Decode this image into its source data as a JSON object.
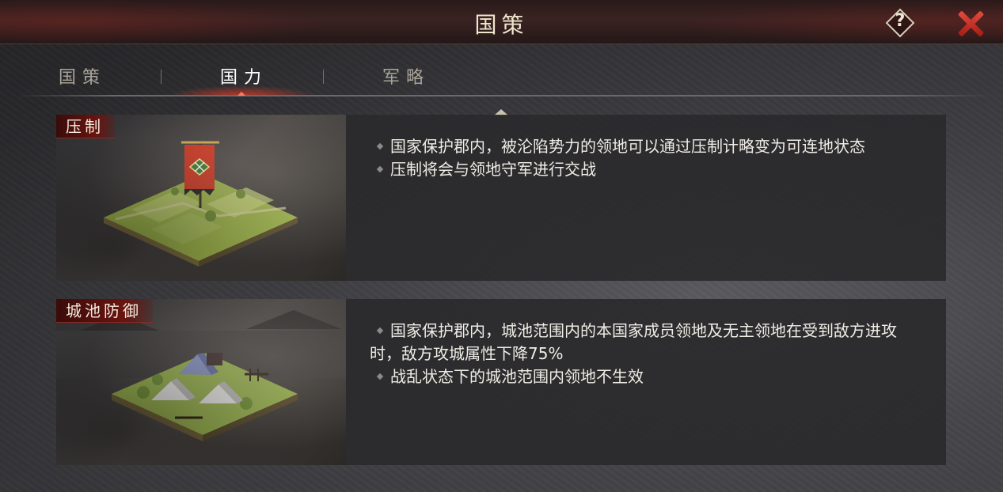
{
  "header": {
    "title": "国策",
    "help_label": "?",
    "close_icon": "close-x-icon",
    "accent_color": "#d8352a"
  },
  "tabs": [
    {
      "label": "国策",
      "active": false
    },
    {
      "label": "国力",
      "active": true
    },
    {
      "label": "军略",
      "active": false
    }
  ],
  "cards": [
    {
      "label": "压制",
      "image": "suppression-territory-banner-image",
      "lines": [
        "国家保护郡内，被沦陷势力的领地可以通过压制计略变为可连地状态",
        "压制将会与领地守军进行交战"
      ]
    },
    {
      "label": "城池防御",
      "image": "city-defense-camp-image",
      "lines": [
        "国家保护郡内，城池范围内的本国家成员领地及无主领地在受到敌方进攻时，敌方攻城属性下降75%",
        "战乱状态下的城池范围内领地不生效"
      ]
    }
  ]
}
